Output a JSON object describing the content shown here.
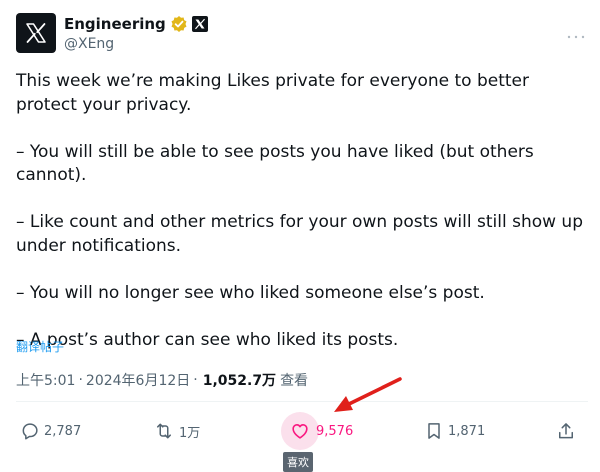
{
  "author": {
    "display_name": "Engineering",
    "handle": "@XEng",
    "verified_color": "#e2b719"
  },
  "post": {
    "paragraphs": [
      "This week we’re making Likes private for everyone to better protect your privacy.",
      "– You will still be able to see posts you have liked (but others cannot).",
      "– Like count and other metrics for your own posts will still show up under notifications.",
      "– You will no longer see who liked someone else’s post.",
      "– A post’s author can see who liked its posts."
    ],
    "translate_label": "翻译帖子"
  },
  "meta": {
    "time": "上午5:01",
    "date": "2024年6月12日",
    "separator": "·",
    "views_count": "1,052.7万",
    "views_label": "查看"
  },
  "actions": {
    "replies": "2,787",
    "reposts": "1万",
    "likes": "9,576",
    "bookmarks": "1,871"
  },
  "tooltip": {
    "label": "喜欢"
  },
  "colors": {
    "like": "#f91880",
    "link": "#1d9bf0",
    "annotation_arrow": "#e0201b",
    "secondary_text": "#536471"
  }
}
